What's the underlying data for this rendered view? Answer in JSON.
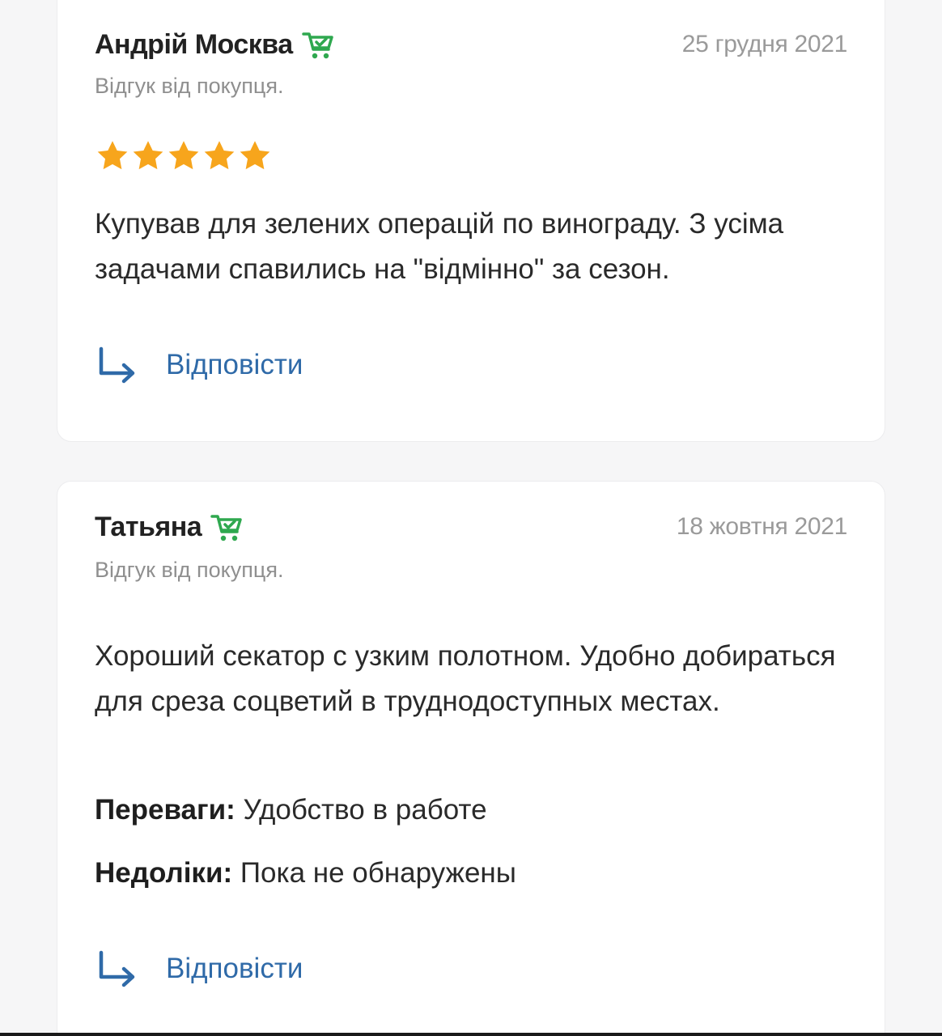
{
  "reviews": [
    {
      "author": "Андрій Москва",
      "date": "25 грудня 2021",
      "source": "Відгук від покупця.",
      "rating": 5,
      "text": "Купував для зелених операцій по винограду. З усіма задачами спавились на \"відмінно\" за сезон.",
      "reply_label": "Відповісти"
    },
    {
      "author": "Татьяна",
      "date": "18 жовтня 2021",
      "source": "Відгук від покупця.",
      "text": "Хороший секатор с узким полотном. Удобно добираться для среза соцветий в труднодоступных местах.",
      "pros_label": "Переваги:",
      "pros": "Удобство в работе",
      "cons_label": "Недоліки:",
      "cons": "Пока не обнаружены",
      "reply_label": "Відповісти"
    }
  ],
  "colors": {
    "star": "#f7a51c",
    "cart_badge": "#2fa84f",
    "reply": "#2f6aa8",
    "date": "#9a9a9a"
  },
  "icons": {
    "buyer_badge": "cart-check-icon",
    "reply": "reply-arrow-icon",
    "star": "star-icon"
  }
}
